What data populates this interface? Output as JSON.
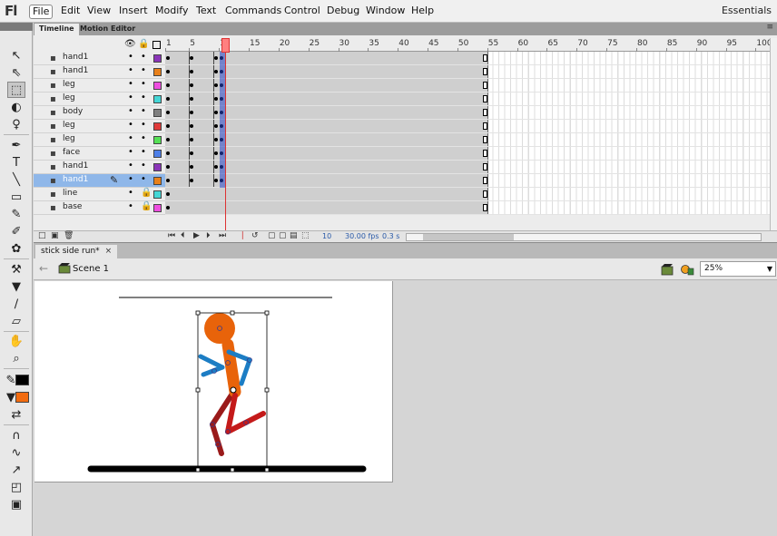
{
  "app": {
    "logo": "Fl",
    "workspace": "Essentials"
  },
  "menu": [
    "File",
    "Edit",
    "View",
    "Insert",
    "Modify",
    "Text",
    "Commands",
    "Control",
    "Debug",
    "Window",
    "Help"
  ],
  "panel_tabs": {
    "timeline": "Timeline",
    "motion_editor": "Motion Editor"
  },
  "ruler": [
    "1",
    "5",
    "10",
    "15",
    "20",
    "25",
    "30",
    "35",
    "40",
    "45",
    "50",
    "55",
    "60",
    "65",
    "70",
    "75",
    "80",
    "85",
    "90",
    "95",
    "100"
  ],
  "layers": [
    {
      "name": "hand1",
      "color": "#8a35b8",
      "locked": false,
      "selected": false
    },
    {
      "name": "hand1",
      "color": "#e8801a",
      "locked": false,
      "selected": false
    },
    {
      "name": "leg",
      "color": "#ee4ee0",
      "locked": false,
      "selected": false
    },
    {
      "name": "leg",
      "color": "#45d6d6",
      "locked": false,
      "selected": false
    },
    {
      "name": "body",
      "color": "#808080",
      "locked": false,
      "selected": false
    },
    {
      "name": "leg",
      "color": "#e03a3a",
      "locked": false,
      "selected": false
    },
    {
      "name": "leg",
      "color": "#55e055",
      "locked": false,
      "selected": false
    },
    {
      "name": "face",
      "color": "#4d7fe8",
      "locked": false,
      "selected": false
    },
    {
      "name": "hand1",
      "color": "#8a35b8",
      "locked": false,
      "selected": false
    },
    {
      "name": "hand1",
      "color": "#e8801a",
      "locked": false,
      "selected": true
    },
    {
      "name": "line",
      "color": "#45d6d6",
      "locked": true,
      "selected": false
    },
    {
      "name": "base",
      "color": "#ee4ee0",
      "locked": true,
      "selected": false
    }
  ],
  "timeline_status": {
    "current_frame": "10",
    "fps": "30.00 fps",
    "time": "0.3 s"
  },
  "document": {
    "tab": "stick side run*",
    "close": "×",
    "scene": "Scene 1",
    "zoom": "25%"
  },
  "colors": {
    "stroke": "#000000",
    "fill": "#f26b0f",
    "playhead": "#ff8080",
    "selected_layer": "#8fb7e9"
  }
}
